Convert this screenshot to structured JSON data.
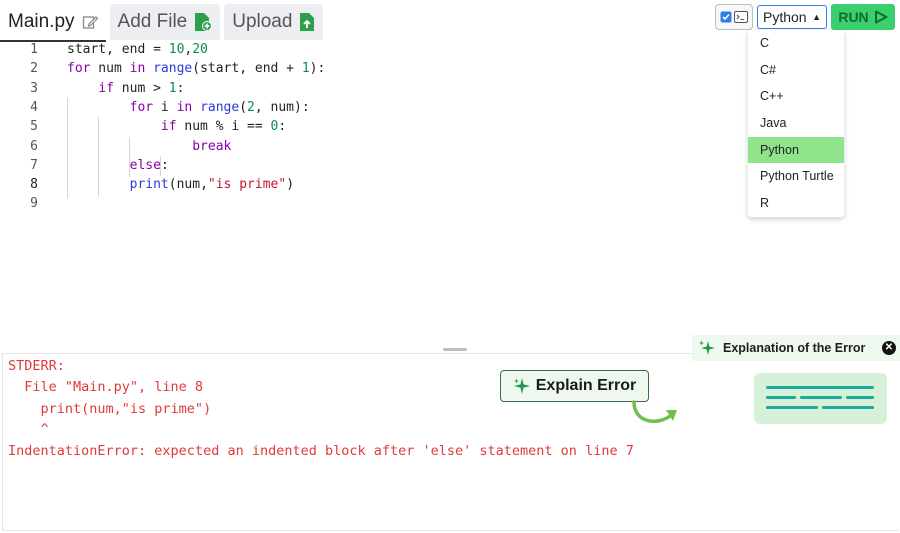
{
  "tabs": [
    {
      "label": "Main.py",
      "icon": "edit-icon"
    },
    {
      "label": "Add File",
      "icon": "file-add-icon"
    },
    {
      "label": "Upload",
      "icon": "file-upload-icon"
    }
  ],
  "toolbar": {
    "language": "Python",
    "run_label": "RUN"
  },
  "language_menu": {
    "options": [
      "C",
      "C#",
      "C++",
      "Java",
      "Python",
      "Python Turtle",
      "R"
    ],
    "selected": "Python"
  },
  "editor": {
    "lines": [
      "1",
      "2",
      "3",
      "4",
      "5",
      "6",
      "7",
      "8",
      "9"
    ],
    "current_line": "8"
  },
  "output": {
    "lines": [
      "STDERR:",
      "  File \"Main.py\", line 8",
      "    print(num,\"is prime\")",
      "    ^",
      "IndentationError: expected an indented block after 'else' statement on line 7"
    ]
  },
  "explain_button": {
    "label": "Explain Error"
  },
  "explanation_panel": {
    "title": "Explanation of the Error"
  },
  "colors": {
    "run": "#3bd06d",
    "selected_option": "#90e58c",
    "error_text": "#e03a3a",
    "accent_blue": "#2f7ee6"
  }
}
